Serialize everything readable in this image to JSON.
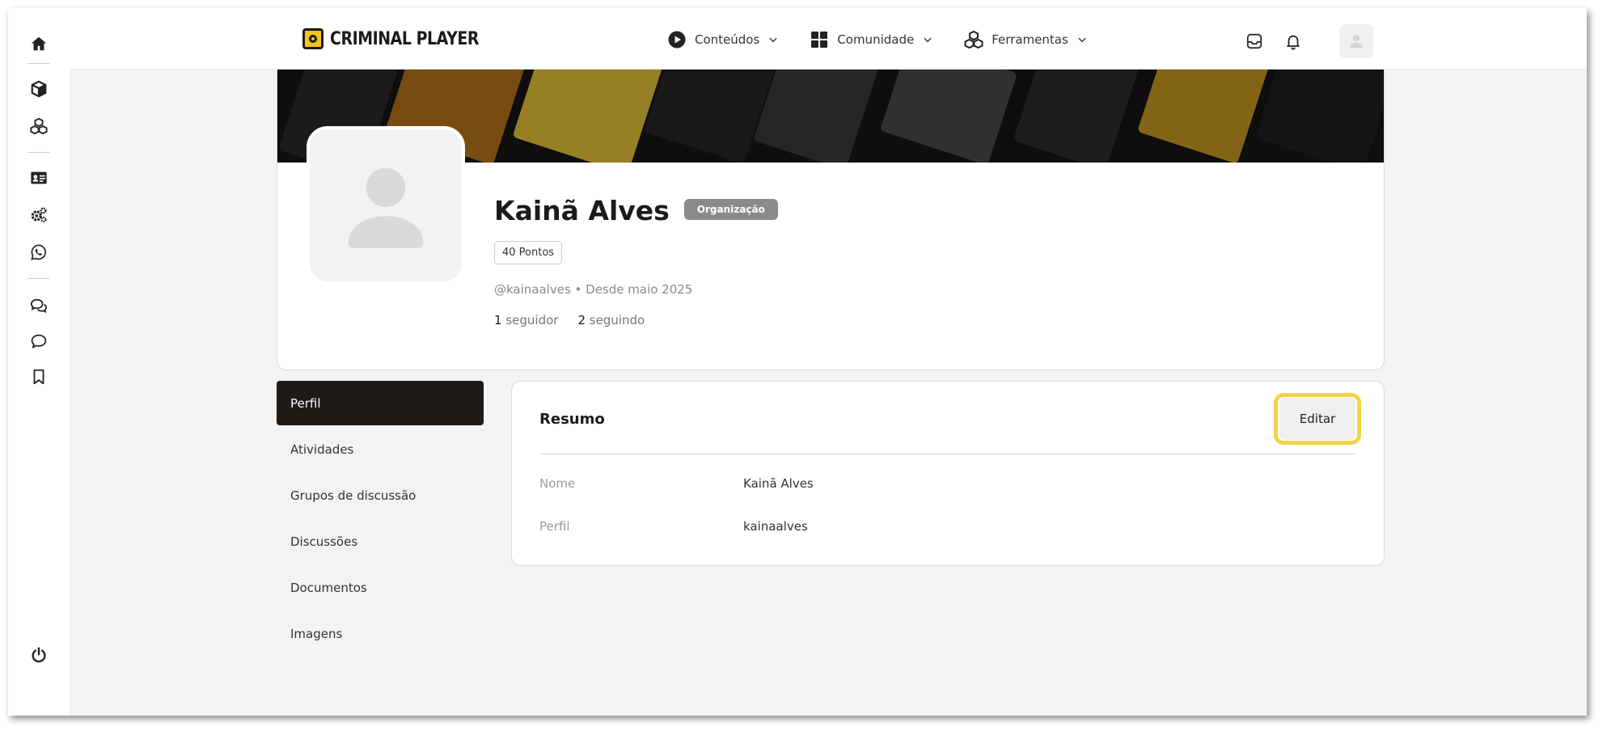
{
  "brand": {
    "name": "CRIMINAL PLAYER",
    "accent": "#f6c21b"
  },
  "sidebar": {
    "icons": [
      "home-icon",
      "box-icon",
      "boxes-icon",
      "id-card-icon",
      "gears-icon",
      "whatsapp-icon",
      "chat-bubbles-icon",
      "chat-bubble-icon",
      "bookmark-icon",
      "power-icon"
    ]
  },
  "nav": {
    "items": [
      {
        "label": "Conteúdos",
        "icon": "play-circle-icon"
      },
      {
        "label": "Comunidade",
        "icon": "grid-icon"
      },
      {
        "label": "Ferramentas",
        "icon": "cubes-icon"
      }
    ]
  },
  "topbar": {
    "actions": [
      "inbox-icon",
      "bell-icon",
      "user-avatar"
    ]
  },
  "profile": {
    "name": "Kainã Alves",
    "badge": "Organização",
    "points": "40 Pontos",
    "meta": "@kainaalves • Desde maio 2025",
    "followers_count": "1",
    "followers_label": "seguidor",
    "following_count": "2",
    "following_label": "seguindo"
  },
  "side_menu": {
    "items": [
      "Perfil",
      "Atividades",
      "Grupos de discussão",
      "Discussões",
      "Documentos",
      "Imagens"
    ],
    "active": "Perfil"
  },
  "summary": {
    "title": "Resumo",
    "edit_label": "Editar",
    "rows": [
      {
        "label": "Nome",
        "value": "Kainã Alves"
      },
      {
        "label": "Perfil",
        "value": "kainaalves"
      }
    ]
  }
}
